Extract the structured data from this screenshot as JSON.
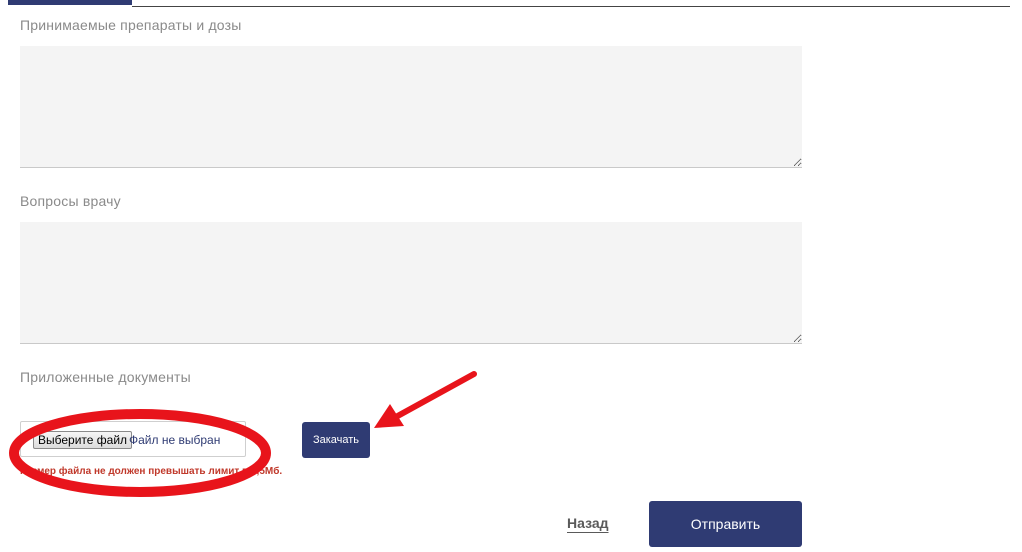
{
  "form": {
    "medications": {
      "label": "Принимаемые препараты и дозы",
      "value": ""
    },
    "questions": {
      "label": "Вопросы врачу",
      "value": ""
    },
    "attachments": {
      "label": "Приложенные документы",
      "choose_file_label": "Выберите файл",
      "file_status": "Файл не выбран",
      "upload_label": "Закачать",
      "size_hint": "Размер файла не должен превышать лимит в 3,5Мб."
    },
    "back_label": "Назад",
    "submit_label": "Отправить"
  },
  "annotations": {
    "circle_color": "#e8141b",
    "arrow_color": "#e8141b",
    "arrow_icon": "arrow-icon"
  },
  "colors": {
    "accent": "#2f3b73",
    "error_text": "#c0392b",
    "field_bg": "#f4f4f4"
  }
}
